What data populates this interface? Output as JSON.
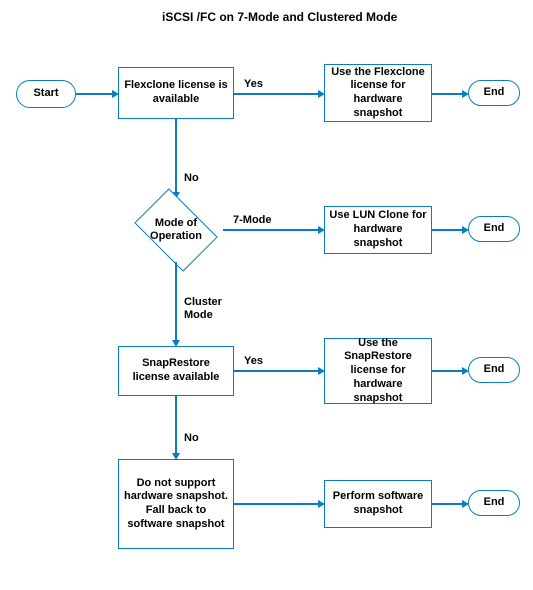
{
  "title": "iSCSI /FC  on 7-Mode and Clustered Mode",
  "terminators": {
    "start": "Start",
    "end": "End"
  },
  "nodes": {
    "flexclone_check": "Flexclone license is available",
    "use_flexclone": "Use the Flexclone license for hardware snapshot",
    "mode_of_operation": "Mode of Operation",
    "use_lun_clone": "Use LUN Clone for hardware snapshot",
    "snaprestore_check": "SnapRestore license available",
    "use_snaprestore": "Use the SnapRestore license for hardware snapshot",
    "no_hw_support": "Do not support hardware snapshot. Fall back to software snapshot",
    "perform_sw": "Perform software snapshot"
  },
  "edge_labels": {
    "yes": "Yes",
    "no": "No",
    "seven_mode": "7-Mode",
    "cluster_mode": "Cluster Mode"
  },
  "chart_data": {
    "type": "flowchart",
    "title": "iSCSI /FC  on 7-Mode and Clustered Mode",
    "nodes": [
      {
        "id": "start",
        "type": "terminator",
        "label": "Start"
      },
      {
        "id": "flexclone_check",
        "type": "decision",
        "label": "Flexclone license is available"
      },
      {
        "id": "use_flexclone",
        "type": "process",
        "label": "Use the Flexclone license for hardware snapshot"
      },
      {
        "id": "end1",
        "type": "terminator",
        "label": "End"
      },
      {
        "id": "mode_of_operation",
        "type": "decision",
        "label": "Mode of Operation"
      },
      {
        "id": "use_lun_clone",
        "type": "process",
        "label": "Use LUN Clone for hardware snapshot"
      },
      {
        "id": "end2",
        "type": "terminator",
        "label": "End"
      },
      {
        "id": "snaprestore_check",
        "type": "decision",
        "label": "SnapRestore license available"
      },
      {
        "id": "use_snaprestore",
        "type": "process",
        "label": "Use the SnapRestore license for hardware snapshot"
      },
      {
        "id": "end3",
        "type": "terminator",
        "label": "End"
      },
      {
        "id": "no_hw_support",
        "type": "process",
        "label": "Do not support hardware snapshot. Fall back to software snapshot"
      },
      {
        "id": "perform_sw",
        "type": "process",
        "label": "Perform software snapshot"
      },
      {
        "id": "end4",
        "type": "terminator",
        "label": "End"
      }
    ],
    "edges": [
      {
        "from": "start",
        "to": "flexclone_check"
      },
      {
        "from": "flexclone_check",
        "to": "use_flexclone",
        "label": "Yes"
      },
      {
        "from": "use_flexclone",
        "to": "end1"
      },
      {
        "from": "flexclone_check",
        "to": "mode_of_operation",
        "label": "No"
      },
      {
        "from": "mode_of_operation",
        "to": "use_lun_clone",
        "label": "7-Mode"
      },
      {
        "from": "use_lun_clone",
        "to": "end2"
      },
      {
        "from": "mode_of_operation",
        "to": "snaprestore_check",
        "label": "Cluster Mode"
      },
      {
        "from": "snaprestore_check",
        "to": "use_snaprestore",
        "label": "Yes"
      },
      {
        "from": "use_snaprestore",
        "to": "end3"
      },
      {
        "from": "snaprestore_check",
        "to": "no_hw_support",
        "label": "No"
      },
      {
        "from": "no_hw_support",
        "to": "perform_sw"
      },
      {
        "from": "perform_sw",
        "to": "end4"
      }
    ]
  }
}
